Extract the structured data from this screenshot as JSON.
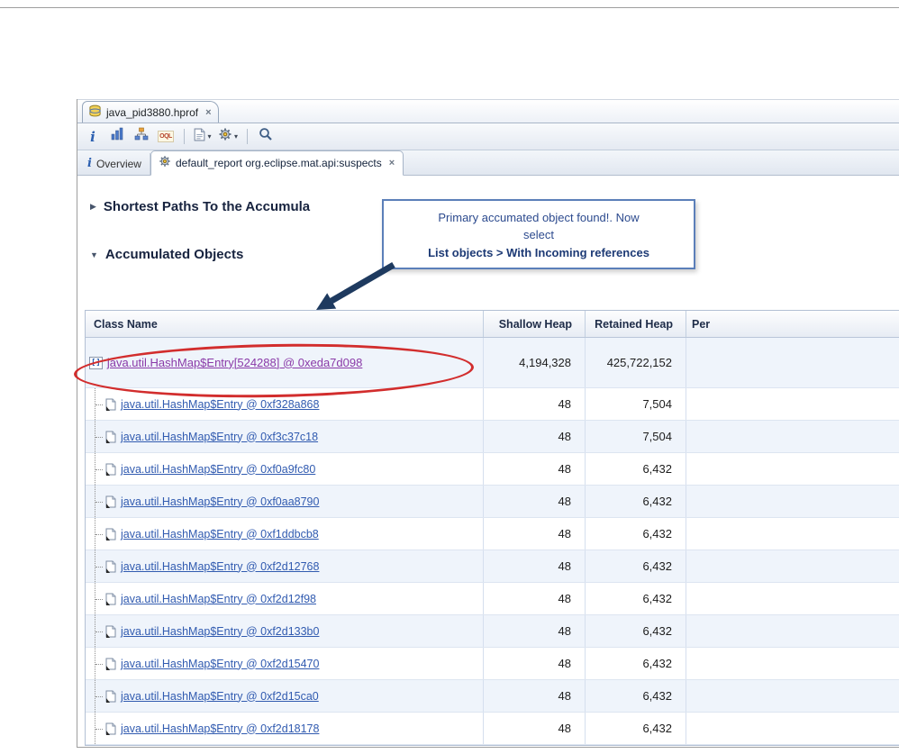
{
  "editor": {
    "tab": {
      "label": "java_pid3880.hprof",
      "close": "×"
    }
  },
  "toolbar": {
    "info_label": "i",
    "oql_label": "OQL"
  },
  "view_tabs": {
    "overview": {
      "icon_label": "i",
      "label": "Overview"
    },
    "suspects": {
      "label": "default_report org.eclipse.mat.api:suspects",
      "close": "×"
    }
  },
  "sections": {
    "shortest_paths": {
      "twistie": "▶",
      "title": "Shortest Paths To the Accumula"
    },
    "accumulated": {
      "twistie": "▼",
      "title": "Accumulated Objects"
    }
  },
  "callout": {
    "line1": "Primary accumated object found!. Now select",
    "line2": "List objects > With Incoming references"
  },
  "table": {
    "columns": {
      "class_name": "Class Name",
      "shallow": "Shallow Heap",
      "retained": "Retained Heap",
      "percentage": "Per"
    },
    "rows": [
      {
        "class_name": "java.util.HashMap$Entry[524288] @ 0xeda7d098",
        "shallow": "4,194,328",
        "retained": "425,722,152",
        "root": true,
        "visited": true
      },
      {
        "class_name": "java.util.HashMap$Entry @ 0xf328a868",
        "shallow": "48",
        "retained": "7,504"
      },
      {
        "class_name": "java.util.HashMap$Entry @ 0xf3c37c18",
        "shallow": "48",
        "retained": "7,504"
      },
      {
        "class_name": "java.util.HashMap$Entry @ 0xf0a9fc80",
        "shallow": "48",
        "retained": "6,432"
      },
      {
        "class_name": "java.util.HashMap$Entry @ 0xf0aa8790",
        "shallow": "48",
        "retained": "6,432"
      },
      {
        "class_name": "java.util.HashMap$Entry @ 0xf1ddbcb8",
        "shallow": "48",
        "retained": "6,432"
      },
      {
        "class_name": "java.util.HashMap$Entry @ 0xf2d12768",
        "shallow": "48",
        "retained": "6,432"
      },
      {
        "class_name": "java.util.HashMap$Entry @ 0xf2d12f98",
        "shallow": "48",
        "retained": "6,432"
      },
      {
        "class_name": "java.util.HashMap$Entry @ 0xf2d133b0",
        "shallow": "48",
        "retained": "6,432"
      },
      {
        "class_name": "java.util.HashMap$Entry @ 0xf2d15470",
        "shallow": "48",
        "retained": "6,432"
      },
      {
        "class_name": "java.util.HashMap$Entry @ 0xf2d15ca0",
        "shallow": "48",
        "retained": "6,432"
      },
      {
        "class_name": "java.util.HashMap$Entry @ 0xf2d18178",
        "shallow": "48",
        "retained": "6,432"
      }
    ]
  },
  "icons": {
    "array": "[]",
    "chevron": "▾"
  },
  "colors": {
    "link": "#315bb0",
    "link-visited": "#8a3aa8",
    "heading": "#17233f",
    "circle": "#d22d2d",
    "callout-border": "#5b7fb9",
    "callout-text": "#2c4a8e",
    "callout-strong": "#1d3a75",
    "arrow": "#1e3a5f"
  }
}
